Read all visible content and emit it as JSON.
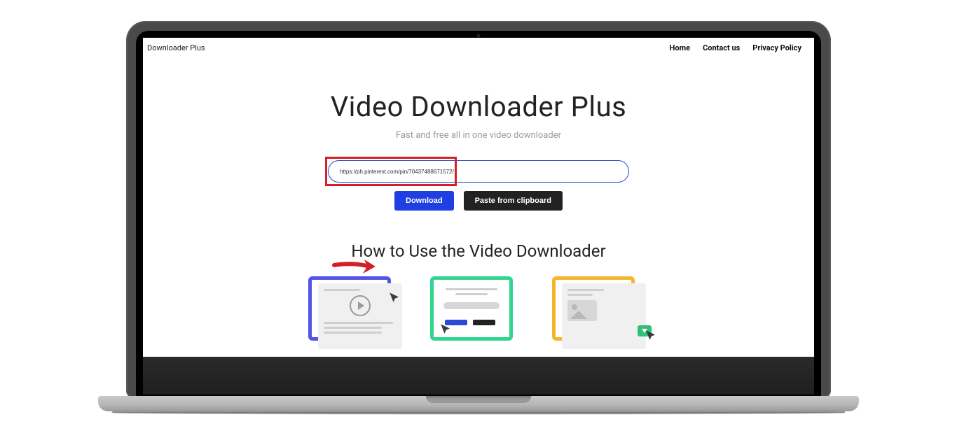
{
  "header": {
    "brand": "Downloader Plus",
    "nav": {
      "home": "Home",
      "contact": "Contact us",
      "privacy": "Privacy Policy"
    }
  },
  "hero": {
    "title": "Video Downloader Plus",
    "subtitle": "Fast and free all in one video downloader"
  },
  "input": {
    "value": "https://ph.pinterest.com/pin/70437488671572/"
  },
  "buttons": {
    "download": "Download",
    "paste": "Paste from clipboard"
  },
  "howto": {
    "title": "How to Use the Video Downloader"
  },
  "colors": {
    "highlight": "#d32027",
    "primary": "#1f3fe0"
  }
}
